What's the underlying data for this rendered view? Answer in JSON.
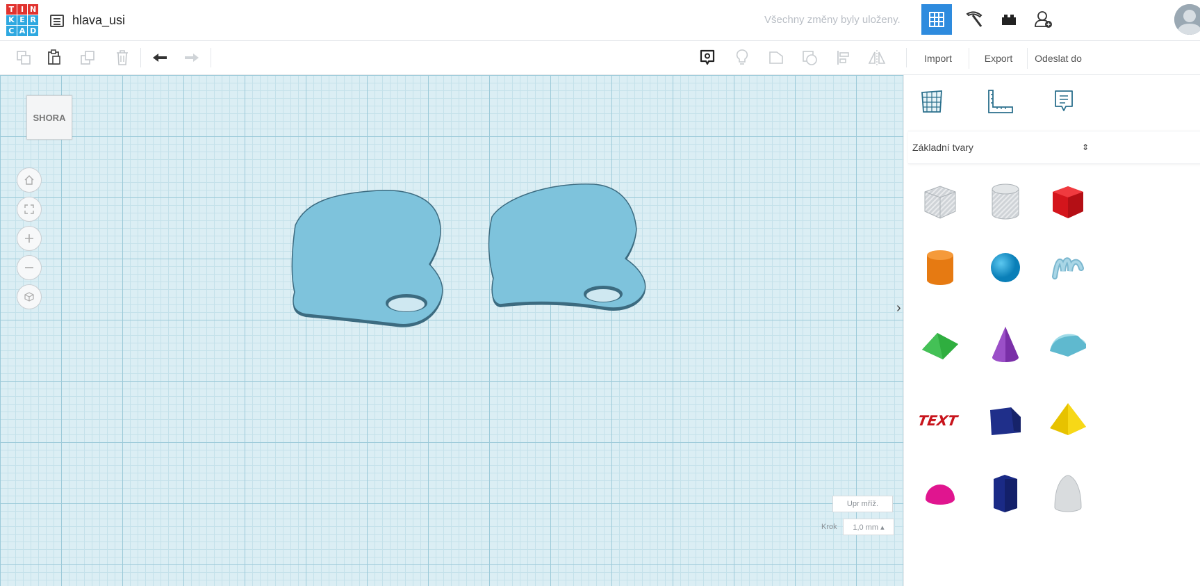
{
  "app": {
    "logo_letters": [
      "T",
      "I",
      "N",
      "K",
      "E",
      "R",
      "C",
      "A",
      "D"
    ],
    "logo_colors": [
      "#e1332f",
      "#e1332f",
      "#e1332f",
      "#2ea8e0",
      "#2ea8e0",
      "#2ea8e0",
      "#2ea8e0",
      "#2ea8e0",
      "#2ea8e0"
    ],
    "design_name": "hlava_usi",
    "save_status": "Všechny změny byly uloženy."
  },
  "topbar_buttons": [
    {
      "icon": "3d-design-grid-icon",
      "active": true
    },
    {
      "icon": "pickaxe-blocks-icon",
      "active": false
    },
    {
      "icon": "lego-brick-icon",
      "active": false
    },
    {
      "icon": "add-user-icon",
      "active": false
    }
  ],
  "toolbar": {
    "tools": [
      "copy-icon",
      "paste-icon",
      "duplicate-icon",
      "delete-icon",
      "undo-icon",
      "redo-icon"
    ],
    "view_tools": [
      "notes-visibility-icon",
      "light-bulb-icon",
      "group-icon",
      "ungroup-icon",
      "align-icon",
      "mirror-icon"
    ],
    "tabs": [
      "Import",
      "Export",
      "Odeslat do"
    ]
  },
  "workplane": {
    "viewcube_label": "SHORA",
    "nav": [
      "home-view-icon",
      "fit-view-icon",
      "zoom-in-icon",
      "zoom-out-icon",
      "perspective-icon"
    ],
    "grid_button": "Upr mříž.",
    "snap_label": "Krok",
    "snap_value": "1,0 mm ▴",
    "colors": {
      "shape_fill": "#7ec3dc",
      "shape_side": "#3c6b80",
      "grid_major": "#9ccad9",
      "grid_minor": "#c4e1ea"
    }
  },
  "panel": {
    "tools": [
      "workplane-icon",
      "ruler-icon",
      "notes-icon"
    ],
    "library_selected": "Základní tvary",
    "shapes": [
      "box-hole-icon",
      "cylinder-hole-icon",
      "box-icon",
      "cylinder-icon",
      "sphere-icon",
      "scribble-icon",
      "roof-icon",
      "cone-icon",
      "round-roof-icon",
      "text-icon",
      "wedge-icon",
      "pyramid-icon",
      "half-sphere-icon",
      "polygon-icon",
      "paraboloid-icon"
    ]
  }
}
